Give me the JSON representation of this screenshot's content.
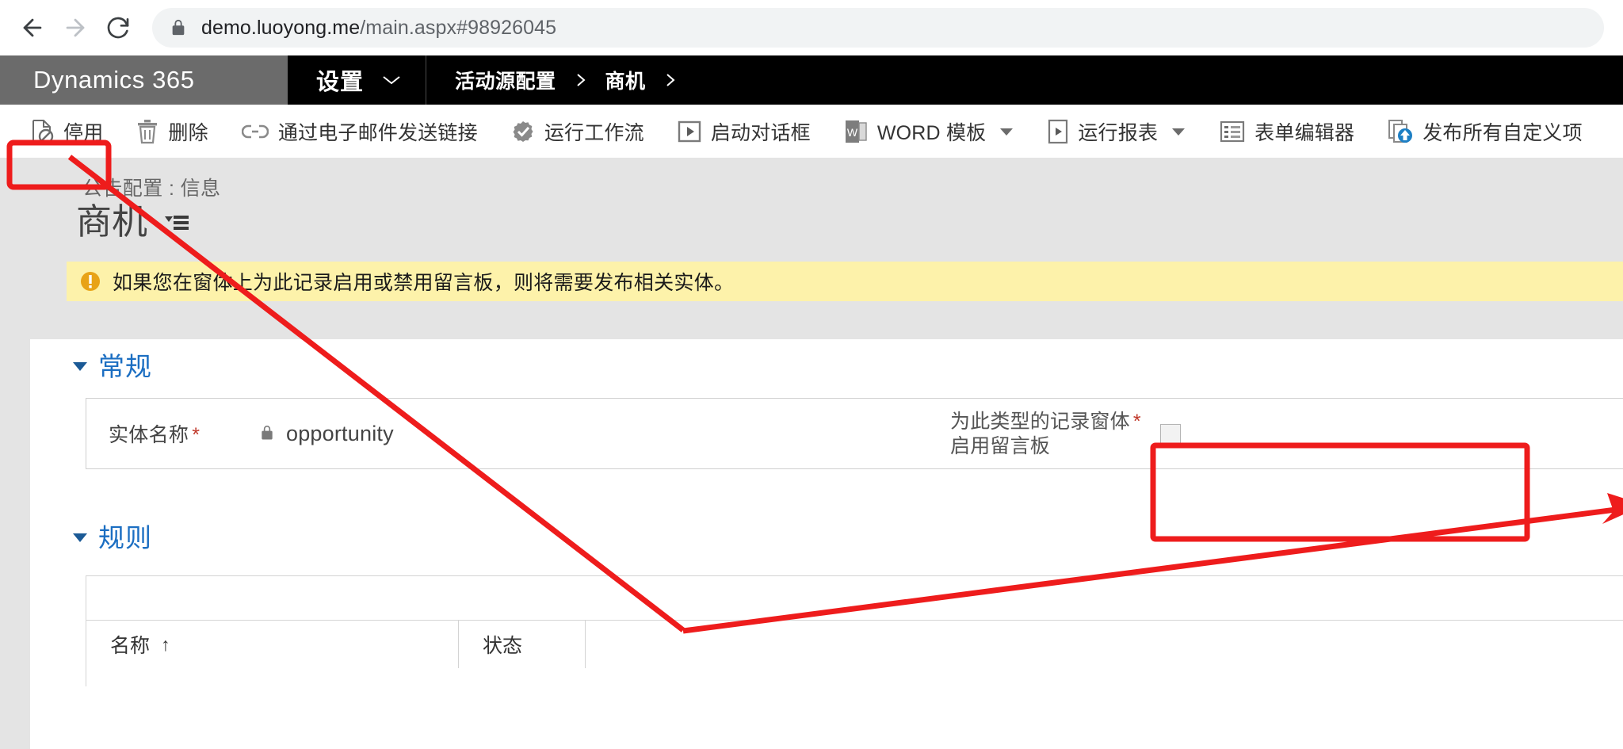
{
  "browser": {
    "back_icon": "arrow-left-icon",
    "forward_icon": "arrow-right-icon",
    "reload_icon": "reload-icon",
    "lock_icon": "lock-icon",
    "url_domain": "demo.luoyong.me",
    "url_path": "/main.aspx#98926045"
  },
  "topnav": {
    "brand": "Dynamics 365",
    "module": "设置",
    "module_caret_icon": "chevron-down-icon",
    "breadcrumb": [
      {
        "label": "活动源配置",
        "sep_icon": "chevron-right-icon"
      },
      {
        "label": "商机",
        "sep_icon": "chevron-right-icon"
      }
    ]
  },
  "commandbar": {
    "buttons": [
      {
        "label": "停用",
        "icon": "deactivate-record-icon",
        "caret": false,
        "highlighted": true
      },
      {
        "label": "删除",
        "icon": "trash-icon",
        "caret": false,
        "highlighted": false
      },
      {
        "label": "通过电子邮件发送链接",
        "icon": "link-icon",
        "caret": false,
        "highlighted": false
      },
      {
        "label": "运行工作流",
        "icon": "workflow-icon",
        "caret": false,
        "highlighted": false
      },
      {
        "label": "启动对话框",
        "icon": "dialog-play-icon",
        "caret": false,
        "highlighted": false
      },
      {
        "label": "WORD 模板",
        "icon": "word-template-icon",
        "caret": true,
        "highlighted": false
      },
      {
        "label": "运行报表",
        "icon": "report-icon",
        "caret": true,
        "highlighted": false
      },
      {
        "label": "表单编辑器",
        "icon": "form-editor-icon",
        "caret": false,
        "highlighted": false
      },
      {
        "label": "发布所有自定义项",
        "icon": "publish-icon",
        "caret": false,
        "highlighted": false
      }
    ]
  },
  "page": {
    "subtitle": "公告配置 : 信息",
    "title": "商机",
    "title_menu_icon": "record-menu-icon"
  },
  "notification": {
    "icon": "warning-icon",
    "text": "如果您在窗体上为此记录启用或禁用留言板，则将需要发布相关实体。"
  },
  "general_section": {
    "title": "常规",
    "collapse_icon": "collapse-triangle-icon",
    "entity_name_label": "实体名称",
    "entity_name_required": "*",
    "entity_name_lock_icon": "lock-icon",
    "entity_name_value": "opportunity",
    "wall_label_line1": "为此类型的记录窗体",
    "wall_label_line2": "启用留言板",
    "wall_required": "*",
    "wall_checked": false
  },
  "rules_section": {
    "title": "规则",
    "collapse_icon": "collapse-triangle-icon",
    "columns": [
      {
        "label": "名称",
        "sort": "↑"
      },
      {
        "label": "状态",
        "sort": ""
      },
      {
        "label": "",
        "sort": ""
      }
    ]
  },
  "annotations": {
    "stroke_color": "#ee1c1c",
    "highlight_stop": "停用-highlight-box",
    "highlight_checkbox": "wall-checkbox-highlight-box",
    "arrow_from_stop": "arrow-to-stop-button",
    "arrow_to_checkbox": "arrow-to-checkbox-field"
  },
  "colors": {
    "brand_bg": "#6b6b6b",
    "nav_bg": "#000000",
    "header_bg": "#e4e4e4",
    "notify_bg": "#fdf2aa",
    "section_title": "#1b6ec2",
    "annotation": "#ee1c1c"
  }
}
